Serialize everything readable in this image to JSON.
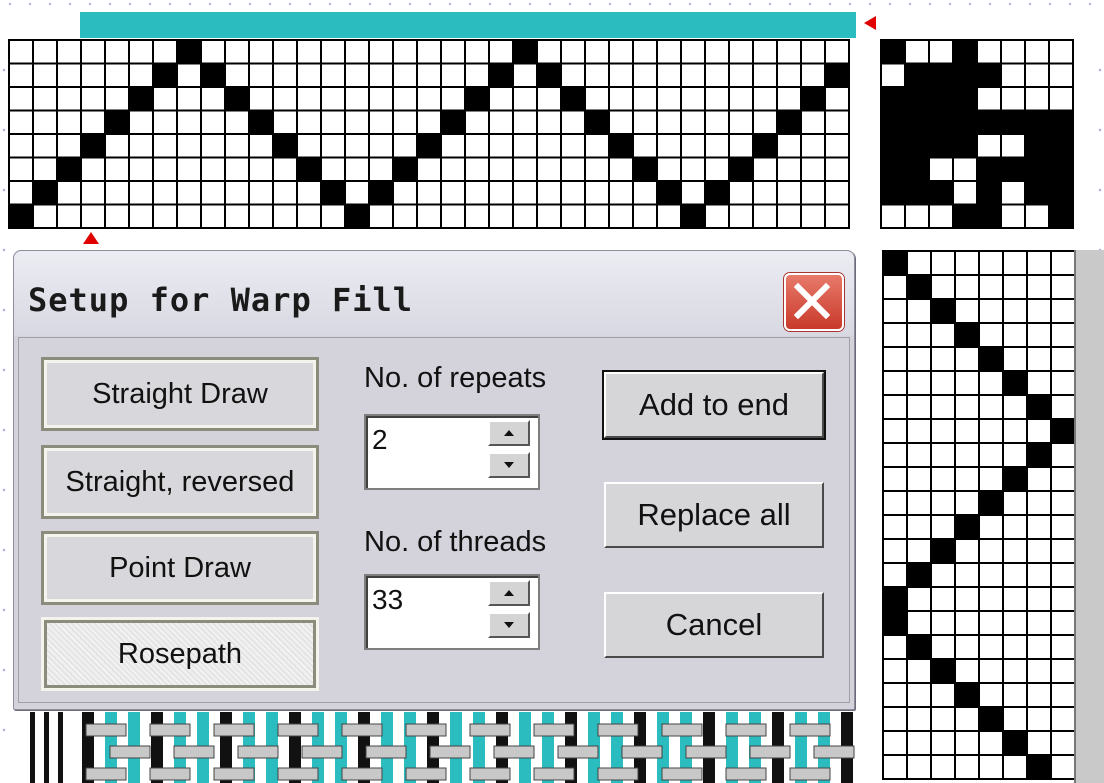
{
  "dialog": {
    "title": "Setup for Warp Fill",
    "pattern_buttons": [
      {
        "label": "Straight Draw",
        "active": false
      },
      {
        "label": "Straight, reversed",
        "active": false
      },
      {
        "label": "Point Draw",
        "active": false
      },
      {
        "label": "Rosepath",
        "active": true
      }
    ],
    "repeats": {
      "label": "No. of repeats",
      "value": "2"
    },
    "threads": {
      "label": "No. of threads",
      "value": "33"
    },
    "actions": {
      "add_to_end": "Add to end",
      "replace_all": "Replace all",
      "cancel": "Cancel"
    }
  },
  "threading": {
    "columns": 35,
    "rows": 8,
    "filled": [
      [
        0,
        1
      ],
      [
        1,
        2
      ],
      [
        2,
        3
      ],
      [
        3,
        4
      ],
      [
        4,
        5
      ],
      [
        5,
        6
      ],
      [
        6,
        7
      ],
      [
        7,
        8
      ],
      [
        8,
        7
      ],
      [
        9,
        6
      ],
      [
        10,
        5
      ],
      [
        11,
        4
      ],
      [
        12,
        3
      ],
      [
        13,
        2
      ],
      [
        14,
        1
      ],
      [
        15,
        2
      ],
      [
        16,
        3
      ],
      [
        17,
        4
      ],
      [
        18,
        5
      ],
      [
        19,
        6
      ],
      [
        20,
        7
      ],
      [
        21,
        8
      ],
      [
        22,
        7
      ],
      [
        23,
        6
      ],
      [
        24,
        5
      ],
      [
        25,
        4
      ],
      [
        26,
        3
      ],
      [
        27,
        2
      ],
      [
        28,
        1
      ],
      [
        29,
        2
      ],
      [
        30,
        3
      ],
      [
        31,
        4
      ],
      [
        32,
        5
      ],
      [
        33,
        6
      ],
      [
        34,
        7
      ]
    ]
  },
  "tieup": {
    "columns": 8,
    "rows": 8,
    "filled": [
      [
        1,
        1
      ],
      [
        4,
        1
      ],
      [
        2,
        2
      ],
      [
        3,
        2
      ],
      [
        4,
        2
      ],
      [
        5,
        2
      ],
      [
        1,
        3
      ],
      [
        2,
        3
      ],
      [
        3,
        3
      ],
      [
        4,
        3
      ],
      [
        1,
        4
      ],
      [
        2,
        4
      ],
      [
        3,
        4
      ],
      [
        4,
        4
      ],
      [
        5,
        4
      ],
      [
        6,
        4
      ],
      [
        7,
        4
      ],
      [
        8,
        4
      ],
      [
        1,
        5
      ],
      [
        2,
        5
      ],
      [
        3,
        5
      ],
      [
        4,
        5
      ],
      [
        7,
        5
      ],
      [
        8,
        5
      ],
      [
        1,
        6
      ],
      [
        2,
        6
      ],
      [
        5,
        6
      ],
      [
        6,
        6
      ],
      [
        7,
        6
      ],
      [
        8,
        6
      ],
      [
        1,
        7
      ],
      [
        2,
        7
      ],
      [
        3,
        7
      ],
      [
        5,
        7
      ],
      [
        7,
        7
      ],
      [
        8,
        7
      ],
      [
        4,
        8
      ],
      [
        5,
        8
      ],
      [
        8,
        8
      ]
    ]
  },
  "treadling": {
    "columns": 8,
    "rows": 22,
    "filled": [
      [
        1,
        1
      ],
      [
        2,
        2
      ],
      [
        3,
        3
      ],
      [
        4,
        4
      ],
      [
        5,
        5
      ],
      [
        6,
        6
      ],
      [
        7,
        7
      ],
      [
        8,
        8
      ],
      [
        7,
        9
      ],
      [
        6,
        10
      ],
      [
        5,
        11
      ],
      [
        4,
        12
      ],
      [
        3,
        13
      ],
      [
        2,
        14
      ],
      [
        1,
        15
      ],
      [
        1,
        16
      ],
      [
        2,
        17
      ],
      [
        3,
        18
      ],
      [
        4,
        19
      ],
      [
        5,
        20
      ],
      [
        6,
        21
      ],
      [
        7,
        22
      ]
    ]
  },
  "colors": {
    "warp_teal": "#2bbcbf",
    "marker_red": "#e00000",
    "dialog_bg": "#d4d3dc",
    "close_red": "#c8392a"
  }
}
